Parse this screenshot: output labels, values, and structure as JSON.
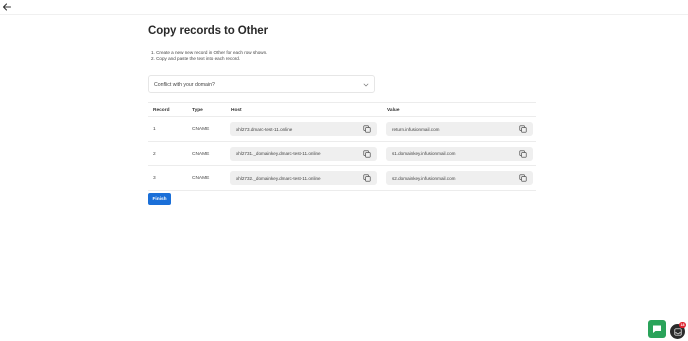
{
  "page": {
    "title": "Copy records to Other",
    "instructions": [
      "1. Create a new new record in Other for each row shown.",
      "2. Copy and paste the text into each record."
    ]
  },
  "accordion": {
    "label": "Conflict with your domain?"
  },
  "table": {
    "headers": {
      "record": "Record",
      "type": "Type",
      "host": "Host",
      "value": "Value"
    },
    "rows": [
      {
        "record": "1",
        "type": "CNAME",
        "host": "xhl273.dmarc-test-11.online",
        "value": "return.infusionmail.com"
      },
      {
        "record": "2",
        "type": "CNAME",
        "host": "xhl2731._domainkey.dmarc-test-11.online",
        "value": "s1.domainkey.infusionmail.com"
      },
      {
        "record": "3",
        "type": "CNAME",
        "host": "xhl2732._domainkey.dmarc-test-11.online",
        "value": "s2.domainkey.infusionmail.com"
      }
    ]
  },
  "finish_label": "Finish",
  "widget": {
    "badge_count": "18"
  },
  "icons": {
    "back": "arrow-left-icon",
    "chevron": "chevron-down-icon",
    "copy": "copy-icon",
    "chat": "chat-icon",
    "widget": "inbox-icon"
  },
  "colors": {
    "primary": "#1a6fd8",
    "chat": "#2aa35a",
    "badge": "#e0232f",
    "field_bg": "#efefef"
  }
}
